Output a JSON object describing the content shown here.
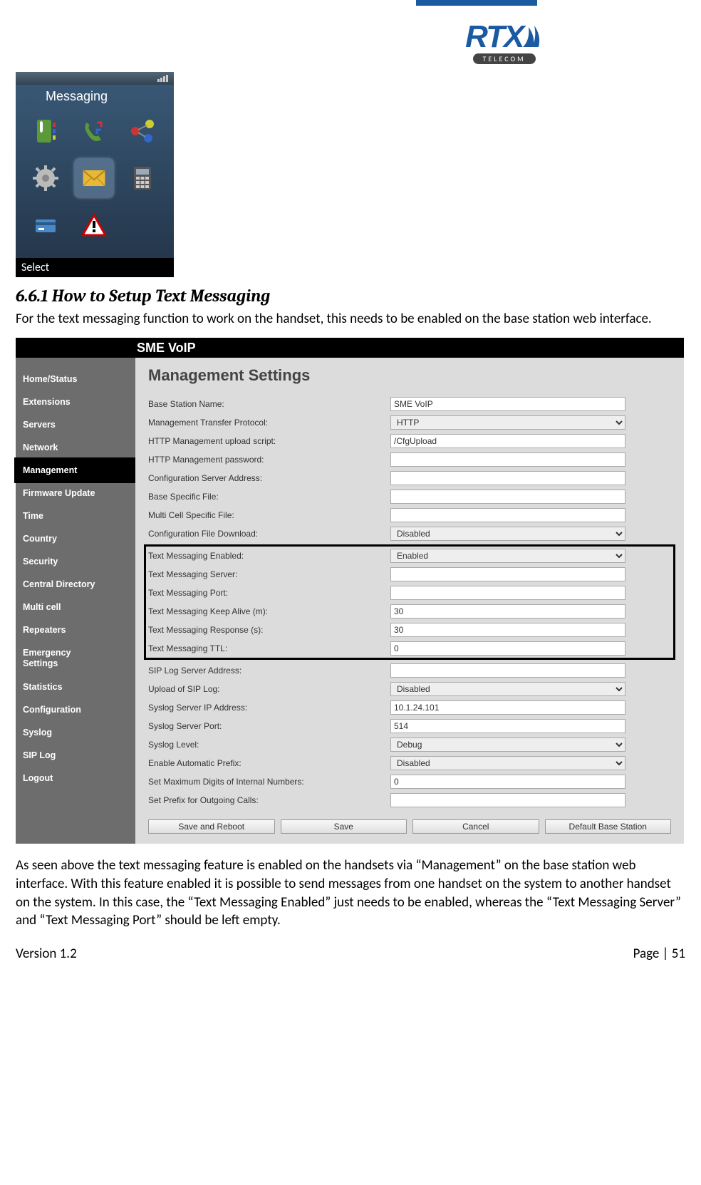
{
  "header": {
    "logo_main": "RTX",
    "logo_sub": "TELECOM"
  },
  "phone": {
    "title": "Messaging",
    "footer": "Select",
    "icons": [
      "contacts-icon",
      "calls-icon",
      "connectivity-icon",
      "settings-icon",
      "messaging-icon",
      "calculator-icon",
      "card-icon",
      "alert-icon"
    ]
  },
  "section": {
    "heading": "6.6.1 How to Setup Text Messaging",
    "intro": "For the text messaging function to work on the handset, this needs to be enabled on the base station web interface.",
    "outro": "As seen above the text messaging feature is enabled on the handsets via “Management” on the base station web interface. With this feature enabled it is possible to send messages from one handset on the system to another handset on the system. In this case, the “Text Messaging Enabled” just needs to be enabled, whereas the “Text Messaging Server” and “Text Messaging Port” should be left empty."
  },
  "webui": {
    "brand": "SME VoIP",
    "page_heading": "Management Settings",
    "nav": [
      "Home/Status",
      "Extensions",
      "Servers",
      "Network",
      "Management",
      "Firmware Update",
      "Time",
      "Country",
      "Security",
      "Central Directory",
      "Multi cell",
      "Repeaters",
      "Emergency Settings",
      "Statistics",
      "Configuration",
      "Syslog",
      "SIP Log",
      "Logout"
    ],
    "nav_active_index": 4,
    "fields_top": [
      {
        "label": "Base Station Name:",
        "type": "text",
        "value": "SME VoIP"
      },
      {
        "label": "Management Transfer Protocol:",
        "type": "select",
        "value": "HTTP"
      },
      {
        "label": "HTTP Management upload script:",
        "type": "text",
        "value": "/CfgUpload"
      },
      {
        "label": "HTTP Management password:",
        "type": "text",
        "value": ""
      },
      {
        "label": "Configuration Server Address:",
        "type": "text",
        "value": ""
      },
      {
        "label": "Base Specific File:",
        "type": "text",
        "value": ""
      },
      {
        "label": "Multi Cell Specific File:",
        "type": "text",
        "value": ""
      },
      {
        "label": "Configuration File Download:",
        "type": "select",
        "value": "Disabled"
      }
    ],
    "fields_highlight": [
      {
        "label": "Text Messaging Enabled:",
        "type": "select",
        "value": "Enabled"
      },
      {
        "label": "Text Messaging Server:",
        "type": "text",
        "value": ""
      },
      {
        "label": "Text Messaging Port:",
        "type": "text",
        "value": ""
      },
      {
        "label": "Text Messaging Keep Alive (m):",
        "type": "text",
        "value": "30"
      },
      {
        "label": "Text Messaging Response (s):",
        "type": "text",
        "value": "30"
      },
      {
        "label": "Text Messaging TTL:",
        "type": "text",
        "value": "0"
      }
    ],
    "fields_bottom": [
      {
        "label": "SIP Log Server Address:",
        "type": "text",
        "value": ""
      },
      {
        "label": "Upload of SIP Log:",
        "type": "select",
        "value": "Disabled"
      },
      {
        "label": "Syslog Server IP Address:",
        "type": "text",
        "value": "10.1.24.101"
      },
      {
        "label": "Syslog Server Port:",
        "type": "text",
        "value": "514"
      },
      {
        "label": "Syslog Level:",
        "type": "select",
        "value": "Debug"
      },
      {
        "label": "Enable Automatic Prefix:",
        "type": "select",
        "value": "Disabled"
      },
      {
        "label": "Set Maximum Digits of Internal Numbers:",
        "type": "text",
        "value": "0"
      },
      {
        "label": "Set Prefix for Outgoing Calls:",
        "type": "text",
        "value": ""
      }
    ],
    "buttons": [
      "Save and Reboot",
      "Save",
      "Cancel",
      "Default Base Station"
    ]
  },
  "footer": {
    "version": "Version 1.2",
    "page": "Page | 51"
  }
}
